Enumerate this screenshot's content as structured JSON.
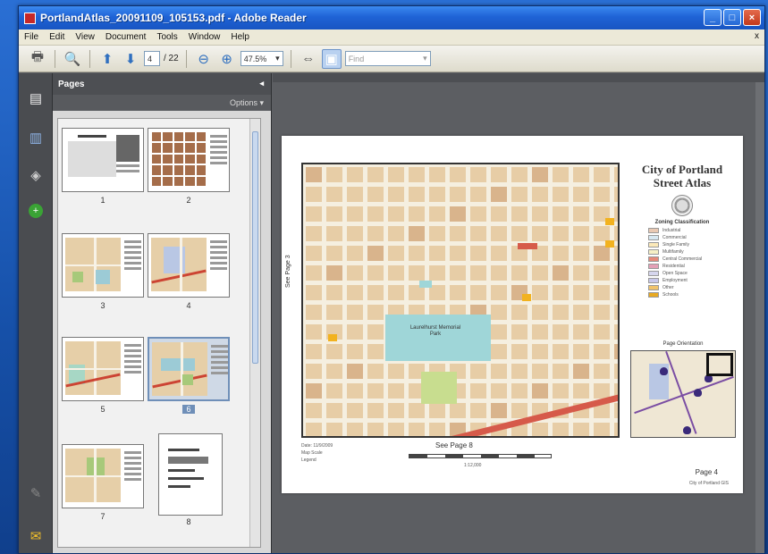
{
  "window": {
    "title": "PortlandAtlas_20091109_105153.pdf - Adobe Reader"
  },
  "menu": {
    "items": [
      "File",
      "Edit",
      "View",
      "Document",
      "Tools",
      "Window",
      "Help"
    ],
    "close_mark": "x"
  },
  "toolbar": {
    "page_current": "4",
    "page_total": "/ 22",
    "zoom": "47.5%",
    "find_placeholder": "Find"
  },
  "panel": {
    "title": "Pages",
    "options_label": "Options ▾",
    "thumb_labels": [
      "1",
      "2",
      "3",
      "4",
      "5",
      "6",
      "7",
      "8"
    ],
    "selected_index": 5
  },
  "document": {
    "atlas_title_1": "City of Portland",
    "atlas_title_2": "Street Atlas",
    "legend_heading": "Zoning Classification",
    "legend_items": [
      {
        "label": "Industrial",
        "color": "#e9c9b3"
      },
      {
        "label": "Commercial",
        "color": "#d7e8f2"
      },
      {
        "label": "Single Family",
        "color": "#fbe9b9"
      },
      {
        "label": "Multifamily",
        "color": "#f6f0c6"
      },
      {
        "label": "Central Commercial",
        "color": "#e68a7a"
      },
      {
        "label": "Residential",
        "color": "#e3a0b6"
      },
      {
        "label": "Open Space",
        "color": "#d6d6ee"
      },
      {
        "label": "Employment",
        "color": "#c7c7ea"
      },
      {
        "label": "Other",
        "color": "#f0c36b"
      },
      {
        "label": "Schools",
        "color": "#e8a921"
      }
    ],
    "overview_title": "Page Orientation",
    "park_label": "Laurelhurst Memorial Park",
    "vertical_label": "See Page 3",
    "see_page": "See Page 8",
    "bottom_left": [
      "Date: 11/9/2009",
      "Map Scale",
      "Legend"
    ],
    "scale_text": "1:12,000",
    "page_label": "Page 4",
    "footer": "City of Portland GIS"
  }
}
